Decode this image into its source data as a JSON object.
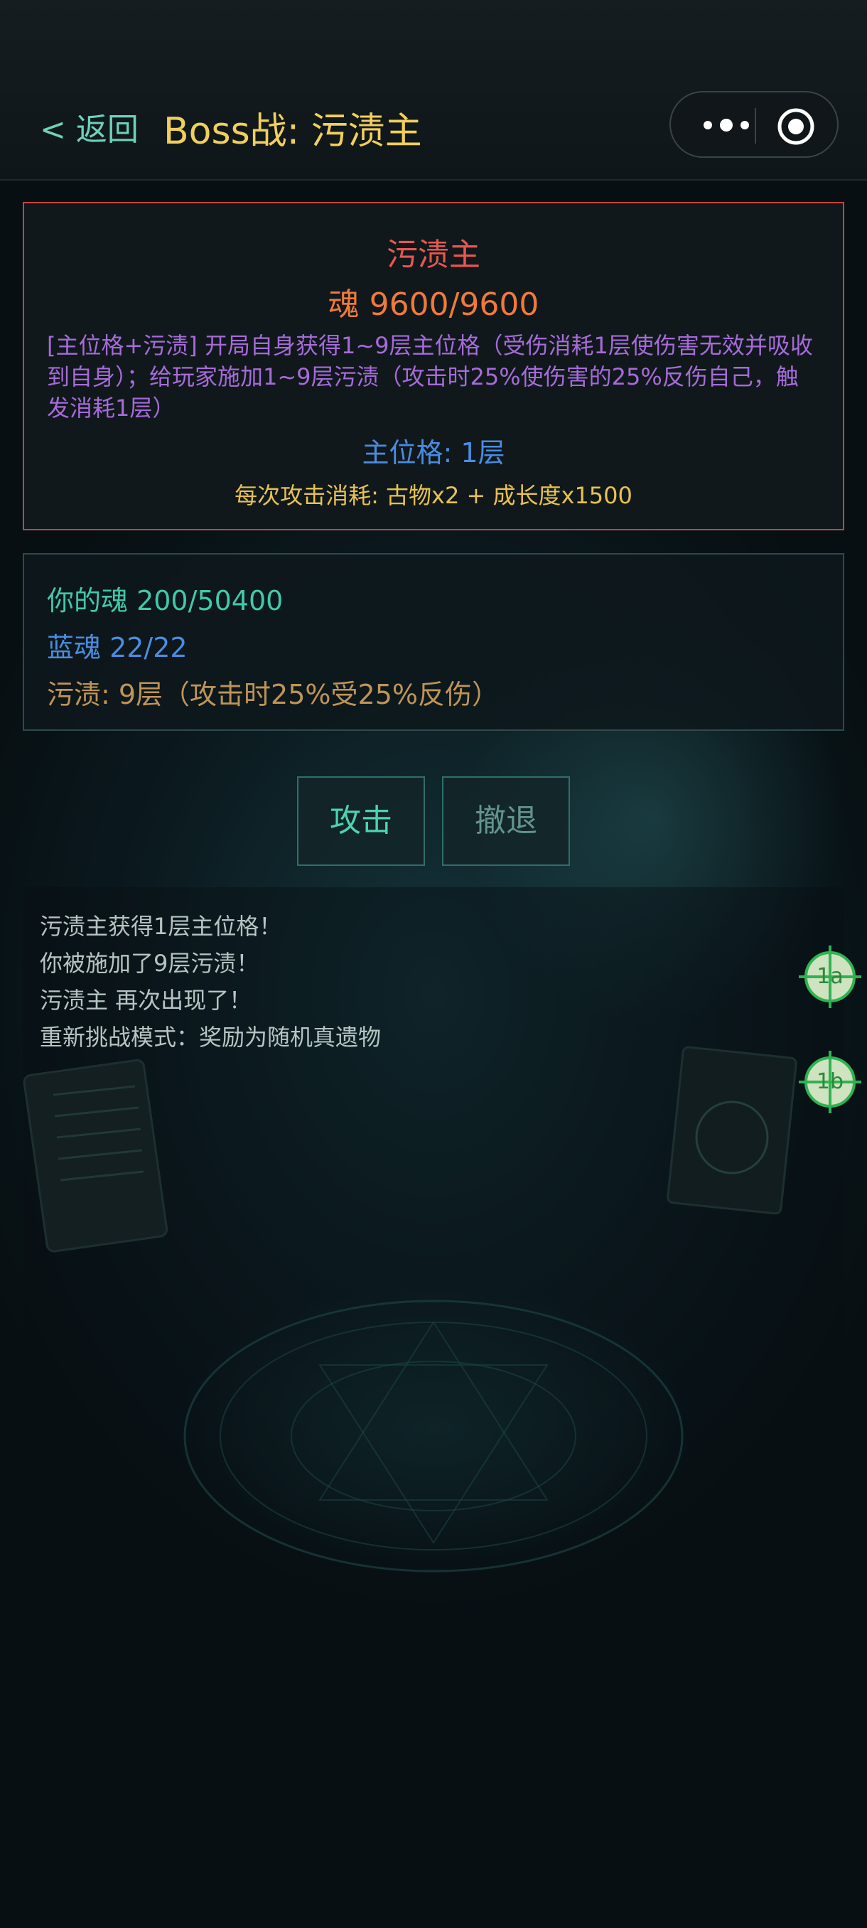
{
  "header": {
    "back_label": "< 返回",
    "title": "Boss战: 污渍主"
  },
  "capsule": {
    "menu_icon": "more-dots-icon",
    "close_icon": "target-circle-icon"
  },
  "boss": {
    "name": "污渍主",
    "hp": "魂 9600/9600",
    "description": "[主位格+污渍] 开局自身获得1~9层主位格（受伤消耗1层使伤害无效并吸收到自身）；给玩家施加1~9层污渍（攻击时25%使伤害的25%反伤自己，触发消耗1层）",
    "layer": "主位格: 1层",
    "cost": "每次攻击消耗: 古物x2 + 成长度x1500"
  },
  "player": {
    "soul": "你的魂 200/50400",
    "blue_soul": "蓝魂 22/22",
    "stain": "污渍: 9层（攻击时25%受25%反伤）"
  },
  "actions": {
    "attack_label": "攻击",
    "retreat_label": "撤退"
  },
  "log": [
    "污渍主获得1层主位格！",
    "你被施加了9层污渍！",
    "污渍主 再次出现了！",
    "重新挑战模式：奖励为随机真遗物"
  ],
  "overlay_badges": [
    "1a",
    "1b"
  ],
  "colors": {
    "accent_gold": "#f1cf5c",
    "boss_red": "#e8574e",
    "teal": "#42c9a5",
    "blue": "#4a8ce0",
    "purple": "#a66bd8"
  }
}
